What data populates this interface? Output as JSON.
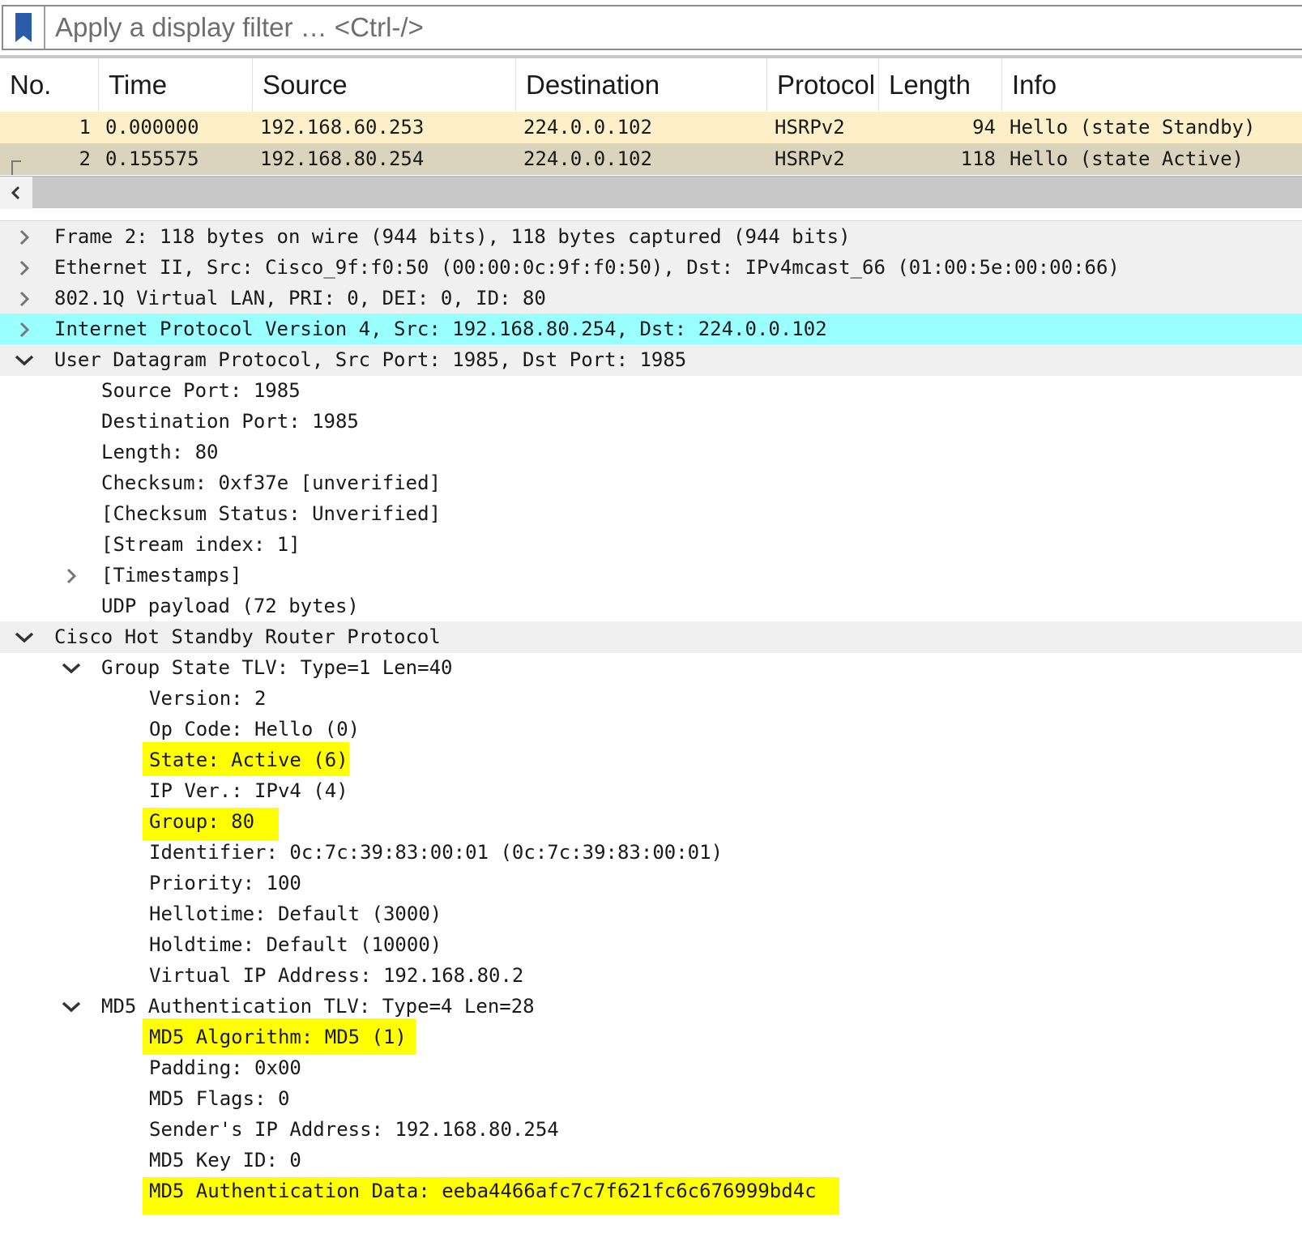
{
  "filter": {
    "placeholder": "Apply a display filter … <Ctrl-/>",
    "value": ""
  },
  "packet_list": {
    "columns": [
      "No.",
      "Time",
      "Source",
      "Destination",
      "Protocol",
      "Length",
      "Info"
    ],
    "rows": [
      {
        "no": "1",
        "time": "0.000000",
        "source": "192.168.60.253",
        "destination": "224.0.0.102",
        "protocol": "HSRPv2",
        "length": "94",
        "info": "Hello (state Standby)"
      },
      {
        "no": "2",
        "time": "0.155575",
        "source": "192.168.80.254",
        "destination": "224.0.0.102",
        "protocol": "HSRPv2",
        "length": "118",
        "info": "Hello (state Active)"
      }
    ],
    "selected_row": "2"
  },
  "details": {
    "frame": "Frame 2: 118 bytes on wire (944 bits), 118 bytes captured (944 bits)",
    "ethernet": "Ethernet II, Src: Cisco_9f:f0:50 (00:00:0c:9f:f0:50), Dst: IPv4mcast_66 (01:00:5e:00:00:66)",
    "vlan": "802.1Q Virtual LAN, PRI: 0, DEI: 0, ID: 80",
    "ip": "Internet Protocol Version 4, Src: 192.168.80.254, Dst: 224.0.0.102",
    "udp": {
      "title": "User Datagram Protocol, Src Port: 1985, Dst Port: 1985",
      "source_port": "Source Port: 1985",
      "destination_port": "Destination Port: 1985",
      "length": "Length: 80",
      "checksum": "Checksum: 0xf37e [unverified]",
      "checksum_status": "[Checksum Status: Unverified]",
      "stream_index": "[Stream index: 1]",
      "timestamps": "[Timestamps]",
      "payload": "UDP payload (72 bytes)"
    },
    "hsrp": {
      "title": "Cisco Hot Standby Router Protocol",
      "group_state_tlv": {
        "title": "Group State TLV: Type=1 Len=40",
        "version": "Version: 2",
        "op_code": "Op Code: Hello (0)",
        "state": "State: Active (6)",
        "ip_ver": "IP Ver.: IPv4 (4)",
        "group": "Group: 80",
        "identifier": "Identifier: 0c:7c:39:83:00:01 (0c:7c:39:83:00:01)",
        "priority": "Priority: 100",
        "hellotime": "Hellotime: Default (3000)",
        "holdtime": "Holdtime: Default (10000)",
        "virtual_ip": "Virtual IP Address: 192.168.80.2"
      },
      "md5_tlv": {
        "title": "MD5 Authentication TLV: Type=4 Len=28",
        "algorithm": "MD5 Algorithm: MD5 (1)",
        "padding": "Padding: 0x00",
        "flags": "MD5 Flags: 0",
        "sender_ip": "Sender's IP Address: 192.168.80.254",
        "key_id": "MD5 Key ID: 0",
        "auth_data": "MD5 Authentication Data: eeba4466afc7c7f621fc6c676999bd4c"
      }
    }
  },
  "colors": {
    "selected_tree_row": "#9affff",
    "highlight": "#ffff00",
    "row_standby": "#fdf0c8",
    "row_active": "#dbd4bc",
    "bookmark": "#2a5caa"
  }
}
